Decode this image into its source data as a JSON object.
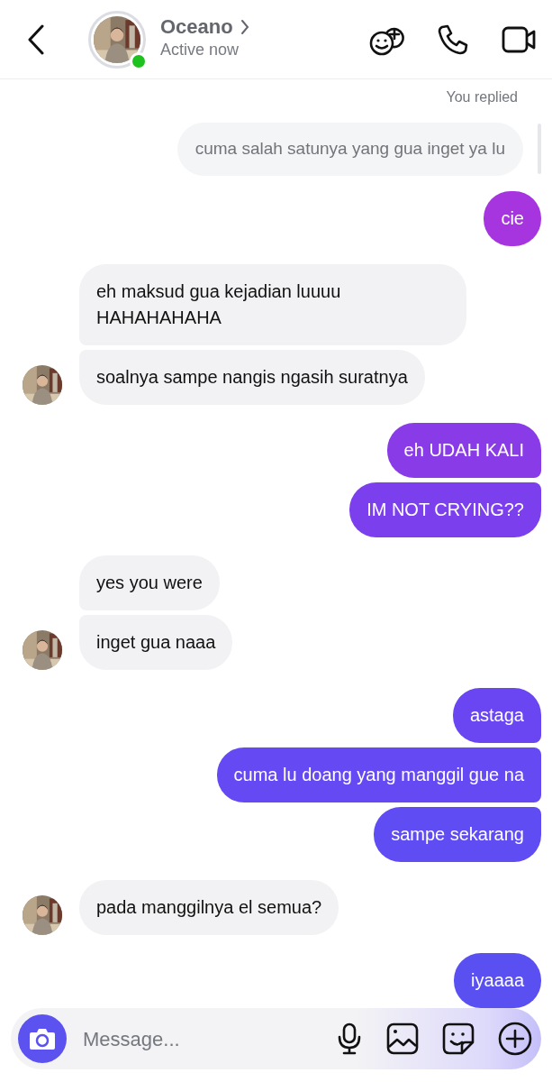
{
  "header": {
    "name": "Oceano",
    "status": "Active now",
    "online": true
  },
  "reply": {
    "note": "You replied",
    "text": "cuma salah satunya yang gua inget ya lu"
  },
  "groups": [
    {
      "kind": "sent",
      "messages": [
        {
          "text": "cie",
          "color": "#a634df"
        }
      ]
    },
    {
      "kind": "received",
      "messages": [
        {
          "text": "eh maksud gua kejadian luuuu HAHAHAHAHA"
        },
        {
          "text": "soalnya sampe nangis ngasih suratnya"
        }
      ]
    },
    {
      "kind": "sent",
      "messages": [
        {
          "text": "eh UDAH KALI",
          "color": "#8a3be8"
        },
        {
          "text": "IM NOT CRYING??",
          "color": "#7c3fee"
        }
      ]
    },
    {
      "kind": "received",
      "messages": [
        {
          "text": "yes you were"
        },
        {
          "text": "inget gua naaa"
        }
      ]
    },
    {
      "kind": "sent",
      "messages": [
        {
          "text": "astaga",
          "color": "#6a46f2"
        },
        {
          "text": "cuma lu doang yang manggil gue na",
          "color": "#6549f3"
        },
        {
          "text": "sampe sekarang",
          "color": "#5f4df3"
        }
      ]
    },
    {
      "kind": "received",
      "messages": [
        {
          "text": "pada manggilnya el semua?"
        }
      ]
    },
    {
      "kind": "sent",
      "messages": [
        {
          "text": "iyaaaa",
          "color": "#5a50f2"
        }
      ]
    }
  ],
  "composer": {
    "placeholder": "Message..."
  }
}
